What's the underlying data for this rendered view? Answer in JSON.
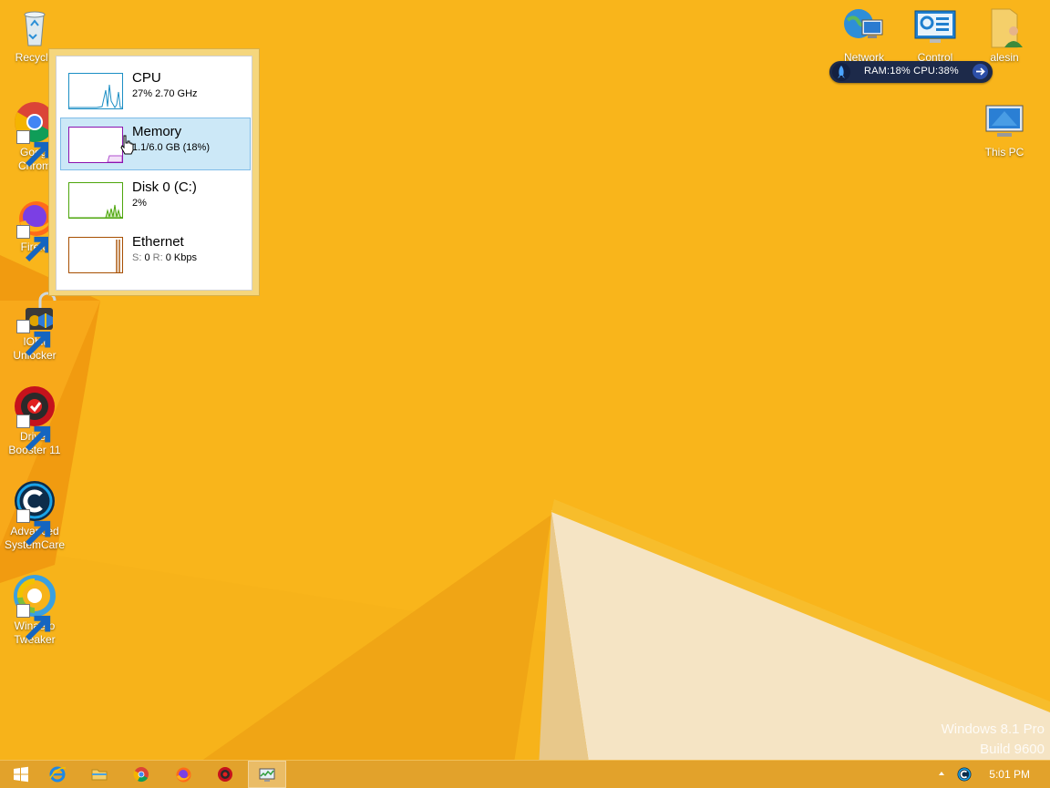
{
  "desktop": {
    "left_icons": [
      {
        "label": "Recycle",
        "icon": "recycle-bin-icon"
      },
      {
        "label": "Googl\nChrom",
        "icon": "chrome-icon"
      },
      {
        "label": "Firefo",
        "icon": "firefox-icon"
      },
      {
        "label": "IObit\nUnlocker",
        "icon": "iobit-unlocker-icon"
      },
      {
        "label": "Driver\nBooster 11",
        "icon": "driver-booster-icon"
      },
      {
        "label": "Advanced\nSystemCare",
        "icon": "advanced-systemcare-icon"
      },
      {
        "label": "Winaero\nTweaker",
        "icon": "winaero-tweaker-icon"
      }
    ],
    "right_icons": [
      {
        "label": "Network",
        "icon": "network-icon"
      },
      {
        "label": "Control Panel",
        "icon": "control-panel-icon"
      },
      {
        "label": "alesin",
        "icon": "user-folder-icon"
      },
      {
        "label": "This PC",
        "icon": "this-pc-icon"
      }
    ]
  },
  "perf_gadget": {
    "text": "RAM:18%  CPU:38%",
    "icon": "rocket-icon"
  },
  "task_manager_popup": {
    "items": [
      {
        "title": "CPU",
        "detail": "27% 2.70 GHz",
        "color": "#1b8ec4",
        "selected": false
      },
      {
        "title": "Memory",
        "detail": "1.1/6.0 GB (18%)",
        "color": "#8b12ae",
        "selected": true
      },
      {
        "title": "Disk 0 (C:)",
        "detail": "2%",
        "color": "#4da60c",
        "selected": false
      },
      {
        "title": "Ethernet",
        "detail_parts": {
          "s_label": "S:",
          "s_value": "0",
          "r_label": "R:",
          "r_value": "0 Kbps"
        },
        "color": "#a74f01",
        "selected": false
      }
    ]
  },
  "watermark": {
    "line1": "Windows 8.1 Pro",
    "line2": "Build 9600"
  },
  "taskbar": {
    "buttons": [
      {
        "name": "start-button",
        "icon": "windows-logo-icon"
      },
      {
        "name": "internet-explorer-button",
        "icon": "internet-explorer-icon"
      },
      {
        "name": "file-explorer-button",
        "icon": "folder-icon"
      },
      {
        "name": "chrome-button",
        "icon": "chrome-icon"
      },
      {
        "name": "firefox-button",
        "icon": "firefox-icon"
      },
      {
        "name": "driver-booster-button",
        "icon": "driver-booster-icon"
      },
      {
        "name": "task-manager-button",
        "icon": "task-manager-icon",
        "active": true
      }
    ],
    "clock": "5:01 PM",
    "colors": {
      "accent": "#f7b31a",
      "taskbar": "#e2a22b",
      "selection": "#cce8f7"
    }
  }
}
